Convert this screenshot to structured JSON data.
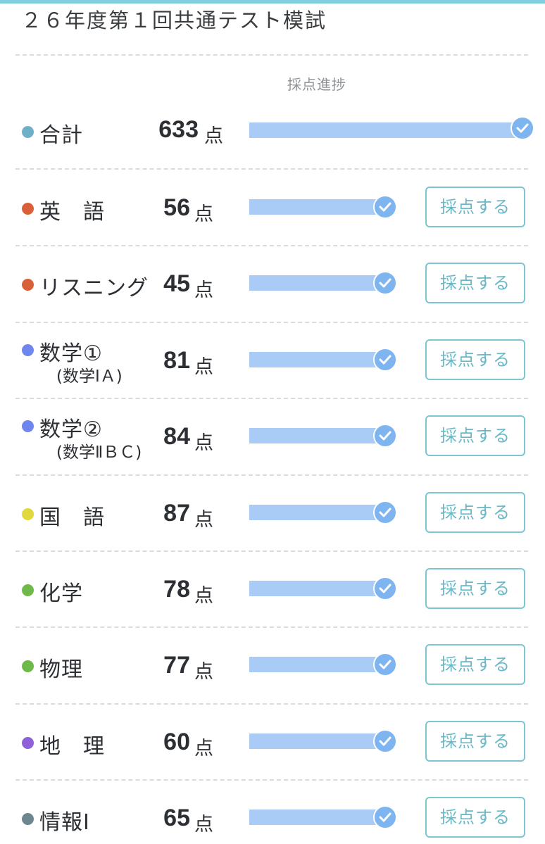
{
  "exam": {
    "title": "２６年度第１回共通テスト模試"
  },
  "progress_header": "採点進捗",
  "unit_label": "点",
  "grade_button_label": "採点する",
  "check_icon": "check-circle-icon",
  "colors": {
    "bar": "#a8ccf5",
    "check": "#7eb5f0",
    "button_border": "#7cc6d2",
    "button_text": "#6ab8c6"
  },
  "total": {
    "label": "合計",
    "score": "633",
    "progress": 1.0,
    "dot_color": "#6fb0c8"
  },
  "subjects": [
    {
      "label": "英　語",
      "sub": "",
      "score": "56",
      "progress": 1.0,
      "dot_color": "#d9613a"
    },
    {
      "label": "リスニング",
      "sub": "",
      "score": "45",
      "progress": 1.0,
      "dot_color": "#d9613a"
    },
    {
      "label": "数学①",
      "sub": "(数学ⅠＡ)",
      "score": "81",
      "progress": 1.0,
      "dot_color": "#6f86ee"
    },
    {
      "label": "数学②",
      "sub": "(数学ⅡＢＣ)",
      "score": "84",
      "progress": 1.0,
      "dot_color": "#6f86ee"
    },
    {
      "label": "国　語",
      "sub": "",
      "score": "87",
      "progress": 1.0,
      "dot_color": "#e0d83c"
    },
    {
      "label": "化学",
      "sub": "",
      "score": "78",
      "progress": 1.0,
      "dot_color": "#6fb84a"
    },
    {
      "label": "物理",
      "sub": "",
      "score": "77",
      "progress": 1.0,
      "dot_color": "#6fb84a"
    },
    {
      "label": "地　理",
      "sub": "",
      "score": "60",
      "progress": 1.0,
      "dot_color": "#9060d8"
    },
    {
      "label": "情報Ⅰ",
      "sub": "",
      "score": "65",
      "progress": 1.0,
      "dot_color": "#6d8690"
    }
  ]
}
